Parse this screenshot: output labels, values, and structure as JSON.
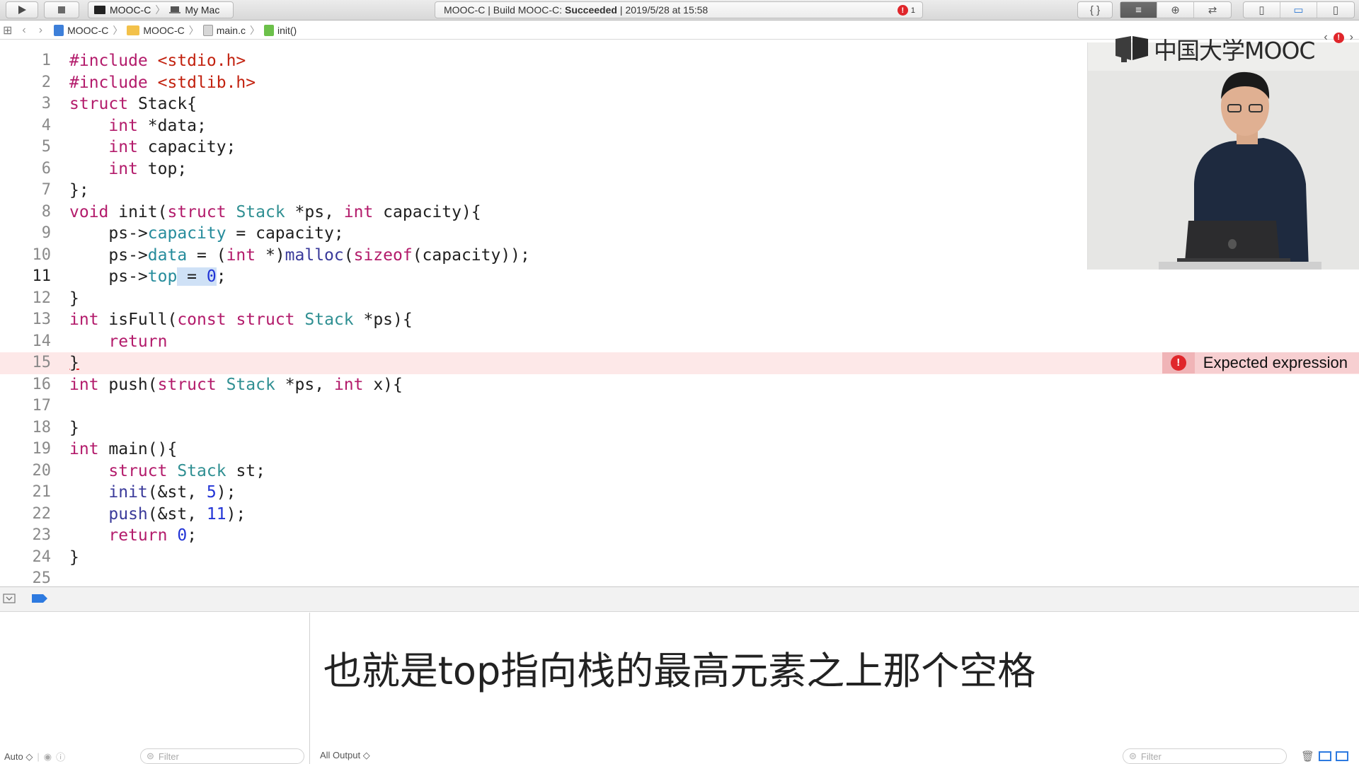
{
  "toolbar": {
    "scheme": "MOOC-C",
    "destination": "My Mac",
    "status_prefix": "MOOC-C | Build MOOC-C:",
    "status_result": "Succeeded",
    "status_time": "| 2019/5/28 at 15:58",
    "error_count": "1",
    "error_color": "#e0262b"
  },
  "jumpbar": {
    "project": "MOOC-C",
    "group": "MOOC-C",
    "file": "main.c",
    "symbol": "init()"
  },
  "editor": {
    "current_line": 11,
    "error_line": 15,
    "lines": [
      {
        "n": "1"
      },
      {
        "n": "2"
      },
      {
        "n": "3"
      },
      {
        "n": "4"
      },
      {
        "n": "5"
      },
      {
        "n": "6"
      },
      {
        "n": "7"
      },
      {
        "n": "8"
      },
      {
        "n": "9"
      },
      {
        "n": "10"
      },
      {
        "n": "11"
      },
      {
        "n": "12"
      },
      {
        "n": "13"
      },
      {
        "n": "14"
      },
      {
        "n": "15"
      },
      {
        "n": "16"
      },
      {
        "n": "17"
      },
      {
        "n": "18"
      },
      {
        "n": "19"
      },
      {
        "n": "20"
      },
      {
        "n": "21"
      },
      {
        "n": "22"
      },
      {
        "n": "23"
      },
      {
        "n": "24"
      },
      {
        "n": "25"
      }
    ],
    "code": {
      "l1_kw": "#include",
      "l1_str": "<stdio.h>",
      "l2_kw": "#include",
      "l2_str": "<stdlib.h>",
      "l3_kw": "struct",
      "l3_rest": " Stack{",
      "l4_kw": "int",
      "l4_rest": " *data;",
      "l5_kw": "int",
      "l5_rest": " capacity;",
      "l6_kw": "int",
      "l6_rest": " top;",
      "l7": "};",
      "l8_a": "void",
      "l8_b": " init(",
      "l8_c": "struct",
      "l8_d": " ",
      "l8_e": "Stack",
      "l8_f": " *ps, ",
      "l8_g": "int",
      "l8_h": " capacity){",
      "l9_a": "ps->",
      "l9_b": "capacity",
      "l9_c": " = capacity;",
      "l10_a": "ps->",
      "l10_b": "data",
      "l10_c": " = (",
      "l10_d": "int",
      "l10_e": " *)",
      "l10_f": "malloc",
      "l10_g": "(",
      "l10_h": "sizeof",
      "l10_i": "(capacity));",
      "l11_a": "ps->",
      "l11_b": "top",
      "l11_c": " = ",
      "l11_d": "0",
      "l11_e": ";",
      "l12": "}",
      "l13_a": "int",
      "l13_b": " isFull(",
      "l13_c": "const",
      "l13_d": " ",
      "l13_e": "struct",
      "l13_f": " ",
      "l13_g": "Stack",
      "l13_h": " *ps){",
      "l14_kw": "return",
      "l15": "}",
      "l16_a": "int",
      "l16_b": " push(",
      "l16_c": "struct",
      "l16_d": " ",
      "l16_e": "Stack",
      "l16_f": " *ps, ",
      "l16_g": "int",
      "l16_h": " x){",
      "l17": "",
      "l18": "}",
      "l19_a": "int",
      "l19_b": " main(){",
      "l20_a": "struct",
      "l20_b": " ",
      "l20_c": "Stack",
      "l20_d": " st;",
      "l21_a": "init",
      "l21_b": "(&st, ",
      "l21_c": "5",
      "l21_d": ");",
      "l22_a": "push",
      "l22_b": "(&st, ",
      "l22_c": "11",
      "l22_d": ");",
      "l23_a": "return",
      "l23_b": " ",
      "l23_c": "0",
      "l23_d": ";",
      "l24": "}"
    },
    "issue_message": "Expected expression"
  },
  "overlay": {
    "logo_text": "中国大学MOOC"
  },
  "subtitle": "也就是top指向栈的最高元素之上那个空格",
  "debug": {
    "variables_scope": "Auto ◇",
    "output_scope": "All Output ◇",
    "left_filter_placeholder": "Filter",
    "right_filter_placeholder": "Filter"
  }
}
